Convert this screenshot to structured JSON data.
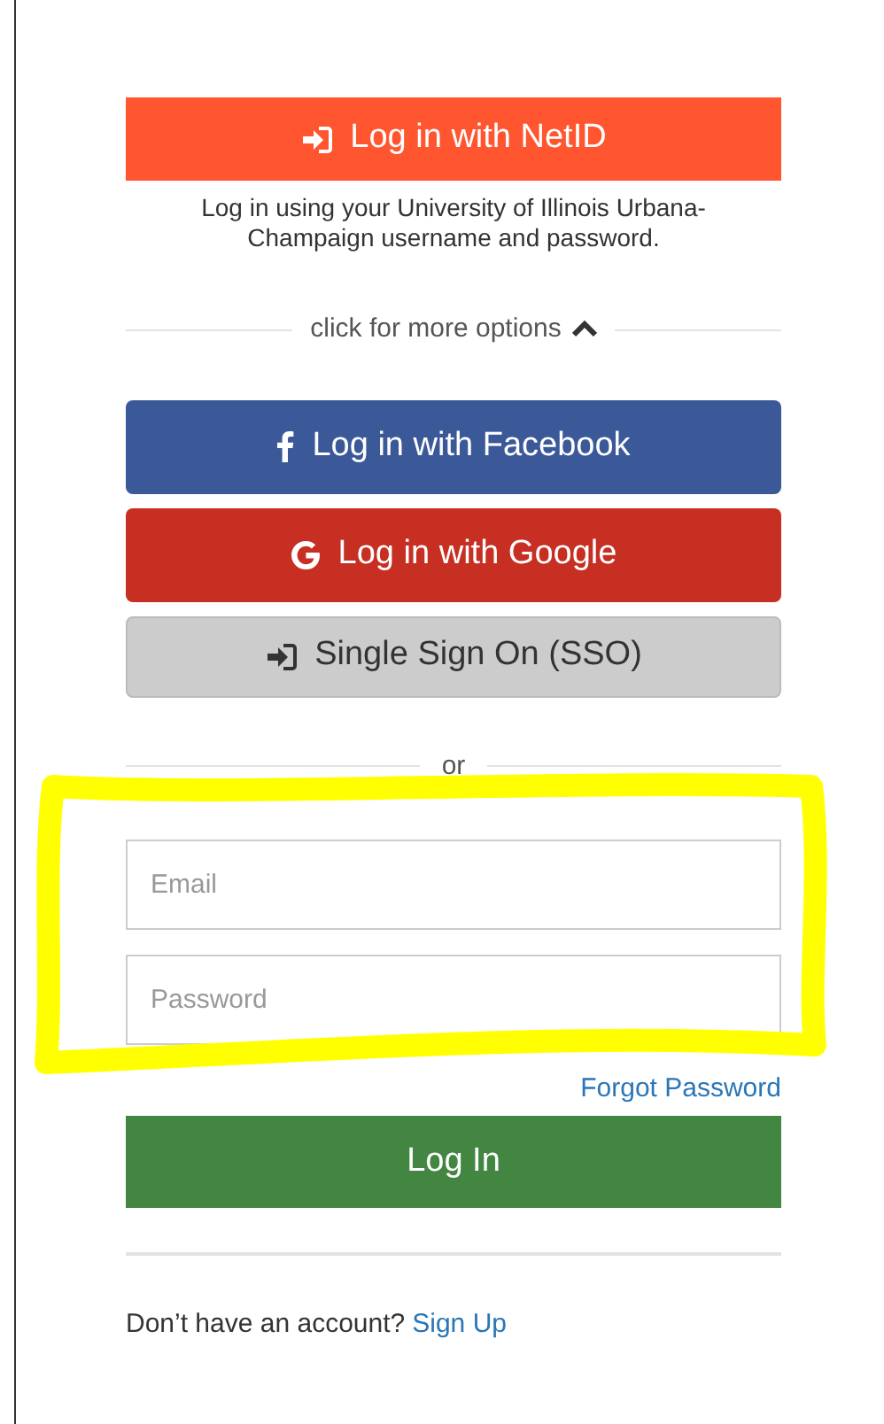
{
  "netid_button": {
    "label": "Log in with NetID"
  },
  "netid_note": "Log in using your University of Illinois Urbana-Champaign username and password.",
  "more_options": {
    "label": "click for more options",
    "expanded": true
  },
  "social_buttons": [
    {
      "kind": "facebook",
      "label": "Log in with Facebook"
    },
    {
      "kind": "google",
      "label": "Log in with Google"
    },
    {
      "kind": "sso",
      "label": "Single Sign On (SSO)"
    }
  ],
  "separator": "or",
  "email_field": {
    "placeholder": "Email"
  },
  "password_field": {
    "placeholder": "Password"
  },
  "forgot_password_link": "Forgot Password",
  "login_button": "Log In",
  "signup_prompt": {
    "text": "Don’t have an account?",
    "link": "Sign Up"
  }
}
